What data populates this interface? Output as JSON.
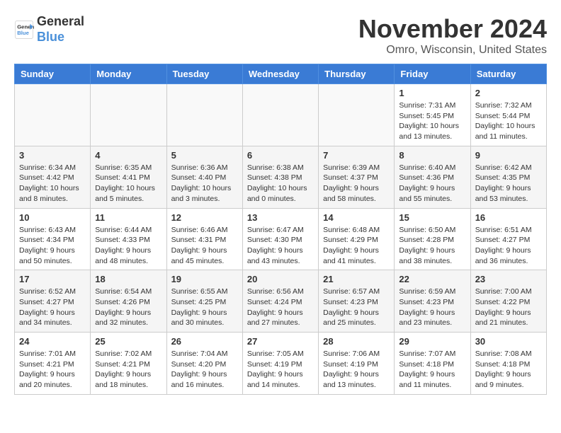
{
  "header": {
    "logo_line1": "General",
    "logo_line2": "Blue",
    "month_title": "November 2024",
    "location": "Omro, Wisconsin, United States"
  },
  "weekdays": [
    "Sunday",
    "Monday",
    "Tuesday",
    "Wednesday",
    "Thursday",
    "Friday",
    "Saturday"
  ],
  "weeks": [
    [
      {
        "day": "",
        "info": ""
      },
      {
        "day": "",
        "info": ""
      },
      {
        "day": "",
        "info": ""
      },
      {
        "day": "",
        "info": ""
      },
      {
        "day": "",
        "info": ""
      },
      {
        "day": "1",
        "info": "Sunrise: 7:31 AM\nSunset: 5:45 PM\nDaylight: 10 hours\nand 13 minutes."
      },
      {
        "day": "2",
        "info": "Sunrise: 7:32 AM\nSunset: 5:44 PM\nDaylight: 10 hours\nand 11 minutes."
      }
    ],
    [
      {
        "day": "3",
        "info": "Sunrise: 6:34 AM\nSunset: 4:42 PM\nDaylight: 10 hours\nand 8 minutes."
      },
      {
        "day": "4",
        "info": "Sunrise: 6:35 AM\nSunset: 4:41 PM\nDaylight: 10 hours\nand 5 minutes."
      },
      {
        "day": "5",
        "info": "Sunrise: 6:36 AM\nSunset: 4:40 PM\nDaylight: 10 hours\nand 3 minutes."
      },
      {
        "day": "6",
        "info": "Sunrise: 6:38 AM\nSunset: 4:38 PM\nDaylight: 10 hours\nand 0 minutes."
      },
      {
        "day": "7",
        "info": "Sunrise: 6:39 AM\nSunset: 4:37 PM\nDaylight: 9 hours\nand 58 minutes."
      },
      {
        "day": "8",
        "info": "Sunrise: 6:40 AM\nSunset: 4:36 PM\nDaylight: 9 hours\nand 55 minutes."
      },
      {
        "day": "9",
        "info": "Sunrise: 6:42 AM\nSunset: 4:35 PM\nDaylight: 9 hours\nand 53 minutes."
      }
    ],
    [
      {
        "day": "10",
        "info": "Sunrise: 6:43 AM\nSunset: 4:34 PM\nDaylight: 9 hours\nand 50 minutes."
      },
      {
        "day": "11",
        "info": "Sunrise: 6:44 AM\nSunset: 4:33 PM\nDaylight: 9 hours\nand 48 minutes."
      },
      {
        "day": "12",
        "info": "Sunrise: 6:46 AM\nSunset: 4:31 PM\nDaylight: 9 hours\nand 45 minutes."
      },
      {
        "day": "13",
        "info": "Sunrise: 6:47 AM\nSunset: 4:30 PM\nDaylight: 9 hours\nand 43 minutes."
      },
      {
        "day": "14",
        "info": "Sunrise: 6:48 AM\nSunset: 4:29 PM\nDaylight: 9 hours\nand 41 minutes."
      },
      {
        "day": "15",
        "info": "Sunrise: 6:50 AM\nSunset: 4:28 PM\nDaylight: 9 hours\nand 38 minutes."
      },
      {
        "day": "16",
        "info": "Sunrise: 6:51 AM\nSunset: 4:27 PM\nDaylight: 9 hours\nand 36 minutes."
      }
    ],
    [
      {
        "day": "17",
        "info": "Sunrise: 6:52 AM\nSunset: 4:27 PM\nDaylight: 9 hours\nand 34 minutes."
      },
      {
        "day": "18",
        "info": "Sunrise: 6:54 AM\nSunset: 4:26 PM\nDaylight: 9 hours\nand 32 minutes."
      },
      {
        "day": "19",
        "info": "Sunrise: 6:55 AM\nSunset: 4:25 PM\nDaylight: 9 hours\nand 30 minutes."
      },
      {
        "day": "20",
        "info": "Sunrise: 6:56 AM\nSunset: 4:24 PM\nDaylight: 9 hours\nand 27 minutes."
      },
      {
        "day": "21",
        "info": "Sunrise: 6:57 AM\nSunset: 4:23 PM\nDaylight: 9 hours\nand 25 minutes."
      },
      {
        "day": "22",
        "info": "Sunrise: 6:59 AM\nSunset: 4:23 PM\nDaylight: 9 hours\nand 23 minutes."
      },
      {
        "day": "23",
        "info": "Sunrise: 7:00 AM\nSunset: 4:22 PM\nDaylight: 9 hours\nand 21 minutes."
      }
    ],
    [
      {
        "day": "24",
        "info": "Sunrise: 7:01 AM\nSunset: 4:21 PM\nDaylight: 9 hours\nand 20 minutes."
      },
      {
        "day": "25",
        "info": "Sunrise: 7:02 AM\nSunset: 4:21 PM\nDaylight: 9 hours\nand 18 minutes."
      },
      {
        "day": "26",
        "info": "Sunrise: 7:04 AM\nSunset: 4:20 PM\nDaylight: 9 hours\nand 16 minutes."
      },
      {
        "day": "27",
        "info": "Sunrise: 7:05 AM\nSunset: 4:19 PM\nDaylight: 9 hours\nand 14 minutes."
      },
      {
        "day": "28",
        "info": "Sunrise: 7:06 AM\nSunset: 4:19 PM\nDaylight: 9 hours\nand 13 minutes."
      },
      {
        "day": "29",
        "info": "Sunrise: 7:07 AM\nSunset: 4:18 PM\nDaylight: 9 hours\nand 11 minutes."
      },
      {
        "day": "30",
        "info": "Sunrise: 7:08 AM\nSunset: 4:18 PM\nDaylight: 9 hours\nand 9 minutes."
      }
    ]
  ]
}
